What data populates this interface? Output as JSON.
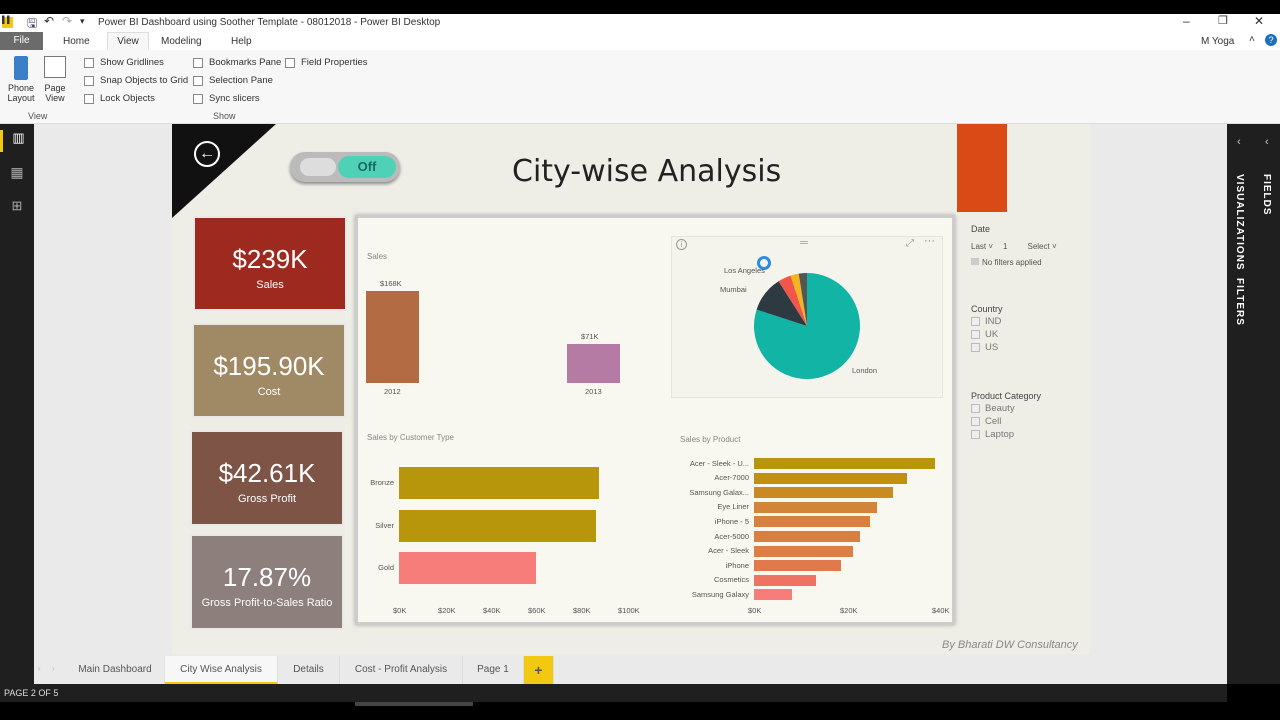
{
  "window": {
    "title": "Power BI Dashboard using Soother Template - 08012018 - Power BI Desktop",
    "user": "M Yoga"
  },
  "menu": {
    "tabs": [
      {
        "label": "File"
      },
      {
        "label": "Home"
      },
      {
        "label": "View"
      },
      {
        "label": "Modeling"
      },
      {
        "label": "Help"
      }
    ],
    "active": "View"
  },
  "ribbon": {
    "view_group": {
      "label": "View",
      "phone_layout": "Phone Layout",
      "page_view": "Page View"
    },
    "show_group": {
      "label": "Show",
      "options": [
        {
          "label": "Show Gridlines",
          "checked": false
        },
        {
          "label": "Snap Objects to Grid",
          "checked": false
        },
        {
          "label": "Lock Objects",
          "checked": false
        },
        {
          "label": "Bookmarks Pane",
          "checked": false
        },
        {
          "label": "Selection Pane",
          "checked": false
        },
        {
          "label": "Sync slicers",
          "checked": false
        },
        {
          "label": "Field Properties",
          "checked": false
        }
      ]
    }
  },
  "report": {
    "title": "City-wise Analysis",
    "toggle_label": "Off",
    "credit": "By Bharati DW Consultancy",
    "kpis": [
      {
        "value": "$239K",
        "label": "Sales",
        "color": "#9e2a1f"
      },
      {
        "value": "$195.90K",
        "label": "Cost",
        "color": "#a08a66"
      },
      {
        "value": "$42.61K",
        "label": "Gross Profit",
        "color": "#7e5447"
      },
      {
        "value": "17.87%",
        "label": "Gross Profit-to-Sales Ratio",
        "color": "#8c7f7c"
      }
    ],
    "accent": "#d94a16"
  },
  "slicers": {
    "date": {
      "title": "Date",
      "mode": "Last",
      "count": "1",
      "unit": "Select",
      "status": "No filters applied"
    },
    "country": {
      "title": "Country",
      "options": [
        "IND",
        "UK",
        "US"
      ]
    },
    "category": {
      "title": "Product Category",
      "options": [
        "Beauty",
        "Cell",
        "Laptop"
      ]
    }
  },
  "chart_data": [
    {
      "type": "bar",
      "title": "Sales",
      "categories": [
        "2012",
        "2013"
      ],
      "values": [
        168,
        71
      ],
      "data_labels": [
        "$168K",
        "$71K"
      ],
      "colors": [
        "#b36b43",
        "#b67ba4"
      ],
      "unit": "$K"
    },
    {
      "type": "pie",
      "labels": [
        "London",
        "Mumbai",
        "Los Angeles",
        "",
        ""
      ],
      "values": [
        80,
        11,
        4,
        2.5,
        2.5
      ],
      "colors": [
        "#12b5a5",
        "#2d3a42",
        "#f0574a",
        "#f4b521",
        "#555"
      ]
    },
    {
      "type": "bar",
      "orientation": "horizontal",
      "title": "Sales by Customer Type",
      "categories": [
        "Bronze",
        "Silver",
        "Gold"
      ],
      "values": [
        89,
        87.5,
        61
      ],
      "colors": [
        "#b8960b",
        "#b8960b",
        "#f77d7a"
      ],
      "xlim": [
        0,
        100
      ],
      "xticks": [
        "$0K",
        "$20K",
        "$40K",
        "$60K",
        "$80K",
        "$100K"
      ],
      "unit": "$K"
    },
    {
      "type": "bar",
      "orientation": "horizontal",
      "title": "Sales by Product",
      "categories": [
        "Acer - Sleek - U...",
        "Acer-7000",
        "Samsung Galax...",
        "Eye Liner",
        "iPhone - 5",
        "Acer-5000",
        "Acer - Sleek",
        "iPhone",
        "Cosmetics",
        "Samsung Galaxy"
      ],
      "values": [
        39.3,
        33.3,
        30.2,
        26.7,
        25.2,
        23,
        21.5,
        18.9,
        13.5,
        8.3
      ],
      "colors": [
        "#b8960b",
        "#bf910f",
        "#c98a22",
        "#d2843a",
        "#d6823e",
        "#d98040",
        "#dc7e45",
        "#e07a4c",
        "#ee7362",
        "#f77d7a"
      ],
      "xlim": [
        0,
        40
      ],
      "xticks": [
        "$0K",
        "$20K",
        "$40K"
      ],
      "unit": "$K"
    }
  ],
  "pages": {
    "tabs": [
      "Main Dashboard",
      "City Wise Analysis",
      "Details",
      "Cost - Profit Analysis",
      "Page 1"
    ],
    "active": "City Wise Analysis",
    "add": "+",
    "status": "PAGE 2 OF 5"
  },
  "panes": {
    "visualizations": "VISUALIZATIONS",
    "filters": "FILTERS",
    "fields": "FIELDS"
  }
}
